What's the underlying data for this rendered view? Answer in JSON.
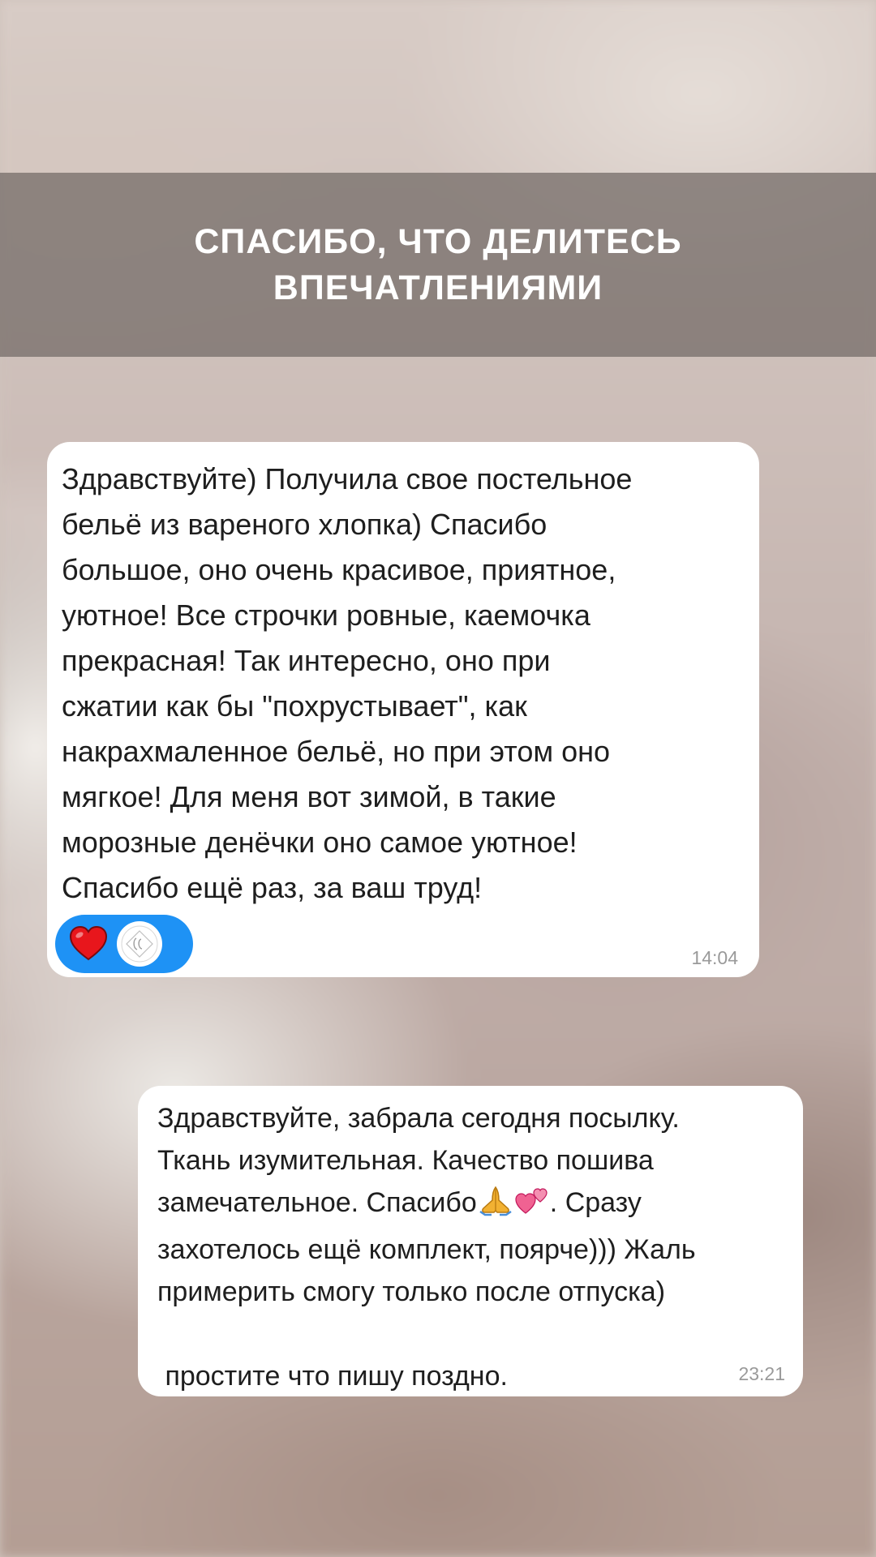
{
  "header": {
    "title_line1": "СПАСИБО, ЧТО ДЕЛИТЕСЬ",
    "title_line2": "ВПЕЧАТЛЕНИЯМИ"
  },
  "messages": [
    {
      "text": "Здравствуйте) Получила свое постельное\nбельё из вареного хлопка) Спасибо\nбольшое, оно очень красивое, приятное,\nуютное! Все строчки ровные, каемочка\nпрекрасная! Так интересно, оно при\nсжатии как бы \"похрустывает\", как\nнакрахмаленное бельё, но при этом оно\nмягкое! Для меня вот зимой, в такие\nморозные денёчки оно самое уютное!\nСпасибо ещё раз, за ваш труд!",
      "time": "14:04",
      "reaction_icon": "heart-icon",
      "reactor_avatar_icon": "brand-logo-icon",
      "reaction_color": "#1e92f5"
    },
    {
      "text_before_emoji": "Здравствуйте, забрала сегодня посылку.\nТкань изумительная. Качество пошива\nзамечательное. Спасибо",
      "emoji_icons": [
        "folded-hands-icon",
        "two-hearts-icon"
      ],
      "text_after_emoji": ". Сразу\nзахотелось ещё комплект, поярче))) Жаль\nпримерить смогу только после отпуска)\n\n простите что пишу поздно.",
      "time": "23:21"
    }
  ]
}
